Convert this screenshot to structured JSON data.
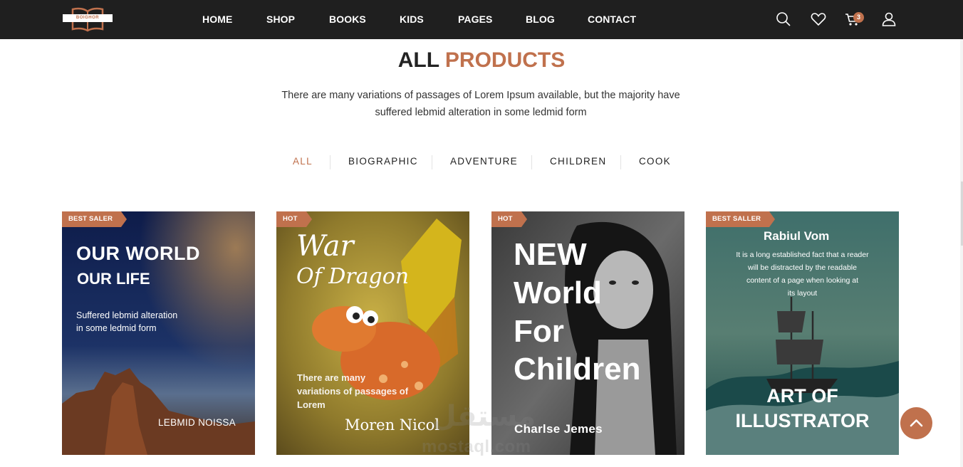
{
  "brand": {
    "logo_text": "BOIGHOR",
    "accent": "#c0714d",
    "nav_bg": "#1f1f1f"
  },
  "nav": {
    "items": [
      "HOME",
      "SHOP",
      "BOOKS",
      "KIDS",
      "PAGES",
      "BLOG",
      "CONTACT"
    ],
    "icons": [
      "search-icon",
      "heart-icon",
      "cart-icon",
      "user-icon"
    ],
    "cart_count": "3"
  },
  "section": {
    "title_main": "ALL",
    "title_accent": "PRODUCTS",
    "description_line1": "There are many variations of passages of Lorem Ipsum available, but the majority have",
    "description_line2": "suffered lebmid alteration in some ledmid form"
  },
  "filters": {
    "items": [
      "ALL",
      "BIOGRAPHIC",
      "ADVENTURE",
      "CHILDREN",
      "COOK"
    ],
    "active": "ALL"
  },
  "products": [
    {
      "badge": "BEST SALER",
      "title_line1": "OUR WORLD",
      "title_line2": "OUR LIFE",
      "subtitle_line1": "Suffered lebmid alteration",
      "subtitle_line2": "in some ledmid form",
      "author": "LEBMID NOISSA"
    },
    {
      "badge": "HOT",
      "title_line1": "War",
      "title_line2": "Of Dragon",
      "subtitle_line1": "There are many",
      "subtitle_line2": "variations of passages of",
      "subtitle_line3": "Lorem",
      "author": "Moren Nicol"
    },
    {
      "badge": "HOT",
      "title_line1": "NEW",
      "title_line2": "World",
      "title_line3": "For",
      "title_line4": "Children",
      "author": "Charlse Jemes"
    },
    {
      "badge": "BEST SALLER",
      "author": "Rabiul Vom",
      "blurb_line1": "It is a long established fact that a reader",
      "blurb_line2": "will be distracted by the readable",
      "blurb_line3": "content of a page when looking at",
      "blurb_line4": "its layout",
      "title_line1": "ART OF",
      "title_line2": "ILLUSTRATOR"
    }
  ],
  "watermark": {
    "arabic": "مستقل",
    "latin": "mostaql.com"
  }
}
